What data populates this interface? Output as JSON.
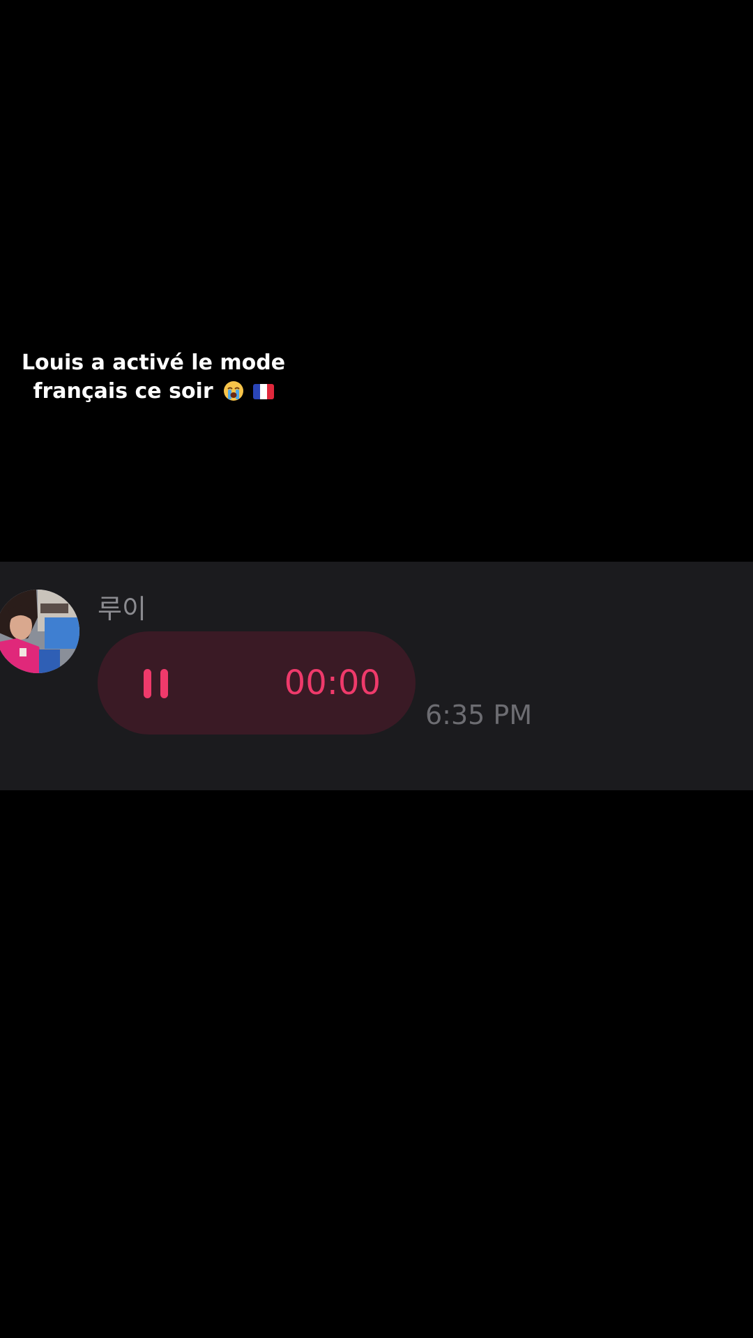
{
  "caption": {
    "line1": "Louis a activé le mode",
    "line2": "français ce soir",
    "emoji_icons": [
      "loudly-crying-face-icon",
      "france-flag-icon"
    ]
  },
  "message": {
    "sender_name": "루이",
    "voice_timer": "00:00",
    "timestamp": "6:35 PM",
    "playback_icon": "pause-icon"
  },
  "colors": {
    "background": "#000000",
    "chat_band": "#1b1b1e",
    "bubble": "#3a1a25",
    "accent": "#ef3a6b",
    "sender_name": "#8b8b90",
    "timestamp": "#6d6d72",
    "caption_text": "#ffffff"
  }
}
